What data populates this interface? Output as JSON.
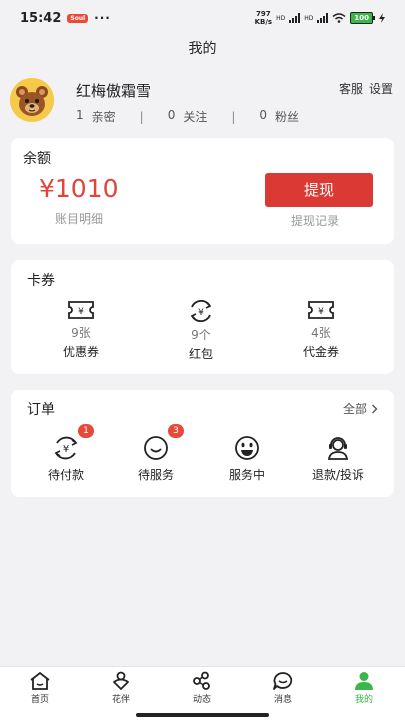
{
  "status_bar": {
    "time": "15:42",
    "badge": "Soul",
    "dots": "···",
    "speed_value": "797",
    "speed_unit": "KB/s",
    "net1": "HD",
    "net2": "HD",
    "battery": "100"
  },
  "header": {
    "title": "我的"
  },
  "profile": {
    "name": "红梅傲霜雪",
    "links": {
      "service": "客服",
      "settings": "设置"
    },
    "stats": [
      {
        "count": "1",
        "label": "亲密"
      },
      {
        "count": "0",
        "label": "关注"
      },
      {
        "count": "0",
        "label": "粉丝"
      }
    ],
    "separator": "|"
  },
  "balance": {
    "title": "余额",
    "amount": "¥1010",
    "detail_link": "账目明细",
    "withdraw_button": "提现",
    "withdraw_record": "提现记录"
  },
  "coupons": {
    "title": "卡券",
    "items": [
      {
        "count": "9张",
        "label": "优惠券",
        "icon": "coupon-ticket-icon"
      },
      {
        "count": "9个",
        "label": "红包",
        "icon": "red-packet-icon"
      },
      {
        "count": "4张",
        "label": "代金券",
        "icon": "voucher-ticket-icon"
      }
    ]
  },
  "orders": {
    "title": "订单",
    "view_all": "全部",
    "items": [
      {
        "label": "待付款",
        "badge": "1",
        "icon": "pending-payment-icon"
      },
      {
        "label": "待服务",
        "badge": "3",
        "icon": "pending-service-icon"
      },
      {
        "label": "服务中",
        "badge": "",
        "icon": "in-service-icon"
      },
      {
        "label": "退款/投诉",
        "badge": "",
        "icon": "refund-complaint-icon"
      }
    ]
  },
  "tabbar": {
    "active_color": "#3cb54a",
    "items": [
      {
        "label": "首页",
        "icon": "home-icon"
      },
      {
        "label": "花伴",
        "icon": "companion-icon"
      },
      {
        "label": "动态",
        "icon": "moments-icon"
      },
      {
        "label": "消息",
        "icon": "message-icon"
      },
      {
        "label": "我的",
        "icon": "profile-icon",
        "active": true
      }
    ]
  },
  "colors": {
    "accent_red": "#da3a33",
    "amount_red": "#e0453a",
    "active_green": "#3cb54a",
    "background": "#f2f2f4"
  }
}
